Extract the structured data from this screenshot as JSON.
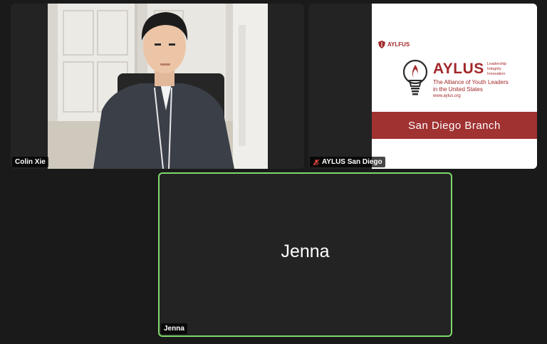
{
  "participants": [
    {
      "name": "Colin Xie"
    },
    {
      "name": "AYLUS San Diego"
    },
    {
      "name": "Jenna"
    }
  ],
  "slide": {
    "logo_small": "AYLFUS",
    "brand": "AYLUS",
    "values": [
      "Leadership",
      "Integrity",
      "Innovation"
    ],
    "full_name_line1": "The Alliance of Youth Leaders",
    "full_name_line2": "in the United States",
    "url": "www.aylus.org",
    "branch": "San Diego Branch"
  },
  "colors": {
    "brand_red": "#a3282a",
    "active_speaker_border": "#7fd86b",
    "tile_bg": "#232323"
  },
  "icons": {
    "muted_mic": "mic-muted-icon"
  }
}
